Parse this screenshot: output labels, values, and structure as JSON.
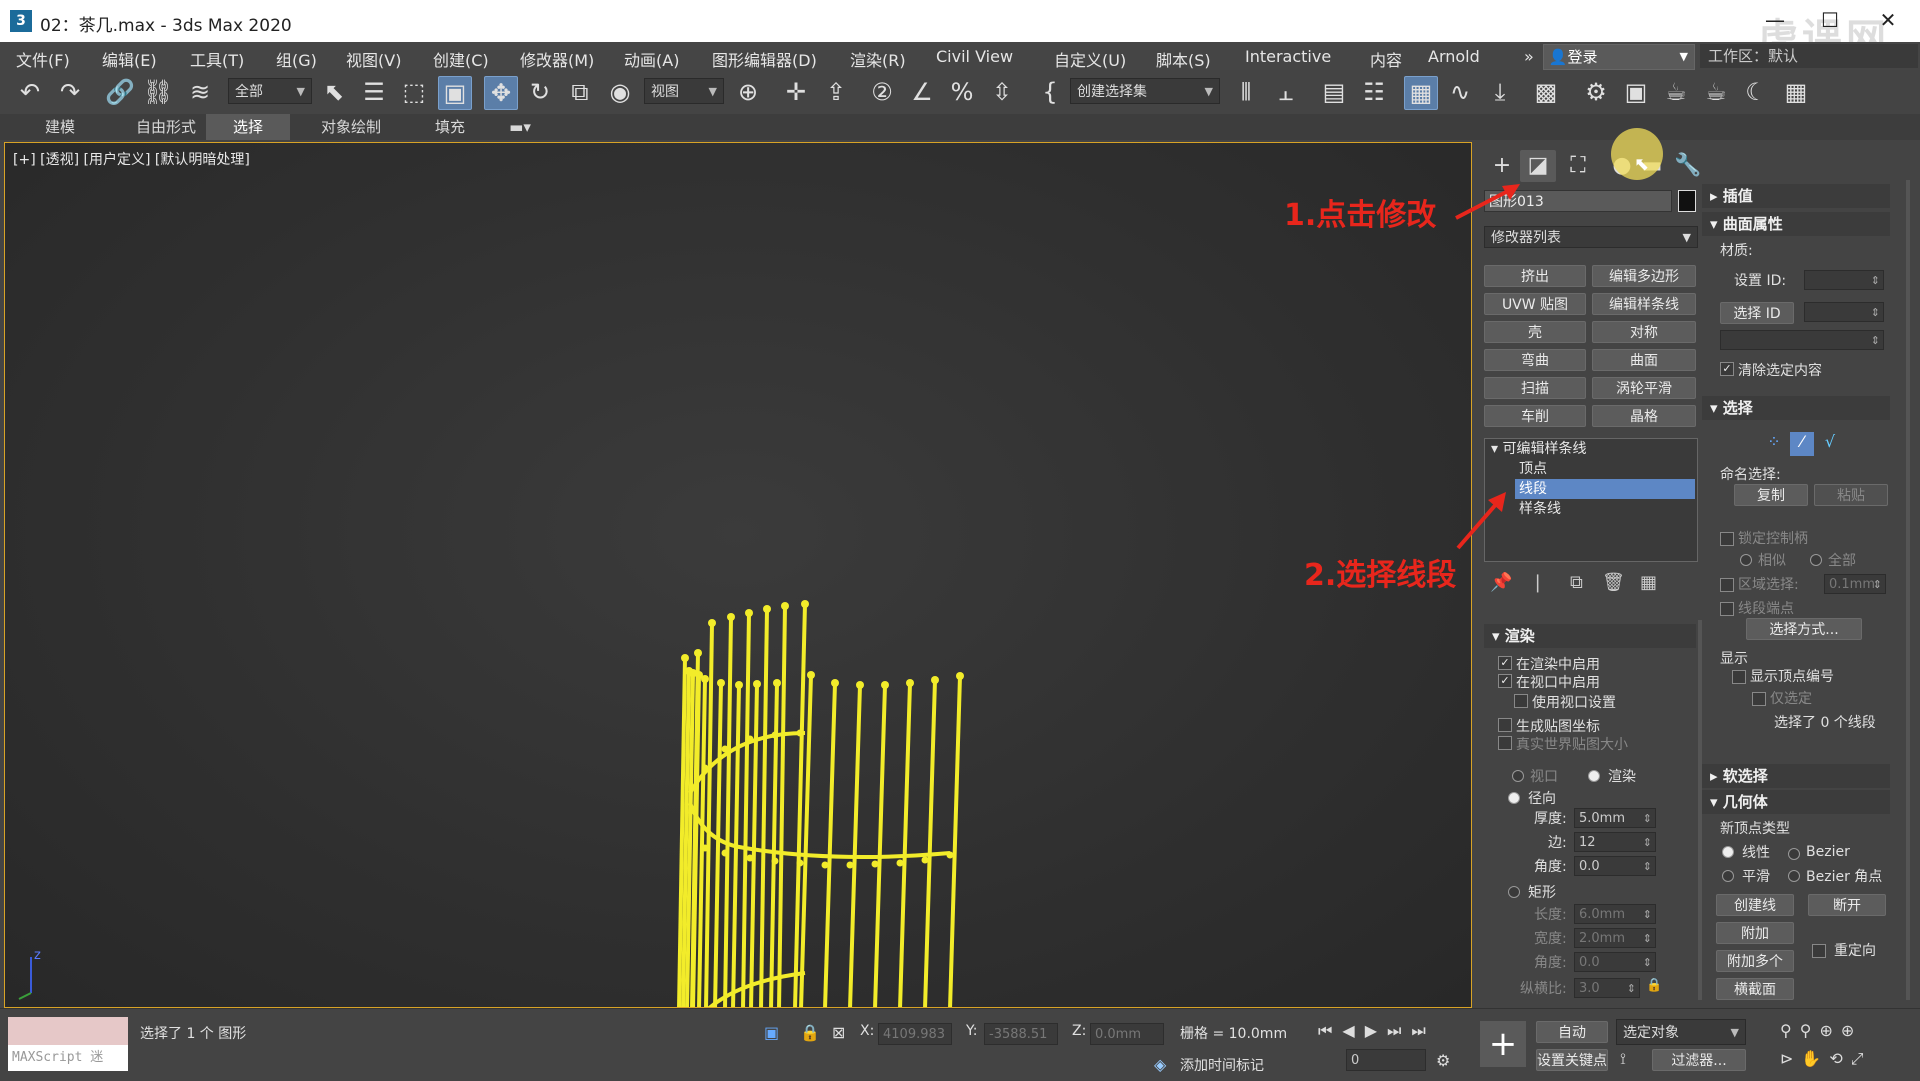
{
  "window": {
    "title": "02：茶几.max - 3ds Max 2020",
    "logo": "3",
    "minimize": "—",
    "maximize": "☐",
    "close": "✕",
    "watermark": "虎课网"
  },
  "menu": {
    "items": [
      "文件(F)",
      "编辑(E)",
      "工具(T)",
      "组(G)",
      "视图(V)",
      "创建(C)",
      "修改器(M)",
      "动画(A)",
      "图形编辑器(D)",
      "渲染(R)",
      "Civil View",
      "自定义(U)",
      "脚本(S)",
      "Interactive",
      "内容",
      "Arnold"
    ],
    "overflow": "»",
    "login": "登录",
    "workspace": "工作区：默认"
  },
  "toolbar": {
    "selection_filter": "全部",
    "ref_coord": "视图",
    "named_selection": "创建选择集"
  },
  "ribbon": {
    "tabs": [
      "建模",
      "自由形式",
      "选择",
      "对象绘制",
      "填充"
    ],
    "selected": "选择"
  },
  "viewport": {
    "label": "[+] [透视] [用户定义] [默认明暗处理]",
    "axis_z": "z",
    "object_color": "#f2ec2a"
  },
  "panel": {
    "object_name": "图形013",
    "modifier_list": "修改器列表",
    "modifier_buttons": [
      "挤出",
      "编辑多边形",
      "UVW 贴图",
      "编辑样条线",
      "壳",
      "对称",
      "弯曲",
      "曲面",
      "扫描",
      "涡轮平滑",
      "车削",
      "晶格"
    ],
    "stack": {
      "root": "可编辑样条线",
      "sub": [
        "顶点",
        "线段",
        "样条线"
      ],
      "selected": "线段"
    },
    "render": {
      "title": "渲染",
      "enable_render": "在渲染中启用",
      "enable_viewport": "在视口中启用",
      "use_viewport": "使用视口设置",
      "gen_map": "生成贴图坐标",
      "real_world": "真实世界贴图大小",
      "viewport": "视口",
      "render_opt": "渲染",
      "radial": "径向",
      "thickness_label": "厚度:",
      "thickness": "5.0mm",
      "sides_label": "边:",
      "sides": "12",
      "angle_label": "角度:",
      "angle": "0.0",
      "rect": "矩形",
      "length_label": "长度:",
      "length": "6.0mm",
      "width_label": "宽度:",
      "width": "2.0mm",
      "angle2_label": "角度:",
      "angle2": "0.0",
      "aspect_label": "纵横比:",
      "aspect": "3.0"
    },
    "right": {
      "interp": "插值",
      "surface": "曲面属性",
      "material": "材质:",
      "set_id": "设置 ID:",
      "select_id": "选择 ID",
      "clear_sel": "清除选定内容",
      "selection": "选择",
      "named_sel": "命名选择:",
      "copy": "复制",
      "paste": "粘贴",
      "lock_handles": "锁定控制柄",
      "alike": "相似",
      "all": "全部",
      "area_sel": "区域选择:",
      "area_val": "0.1mm",
      "seg_end": "线段端点",
      "sel_by": "选择方式...",
      "display": "显示",
      "show_vnum": "显示顶点编号",
      "sel_only": "仅选定",
      "sel_count": "选择了 0 个线段",
      "soft_sel": "软选择",
      "geometry": "几何体",
      "new_vtype": "新顶点类型",
      "linear": "线性",
      "bezier": "Bezier",
      "smooth": "平滑",
      "bezier_corner": "Bezier 角点",
      "create_line": "创建线",
      "break": "断开",
      "attach": "附加",
      "reorient": "重定向",
      "attach_mult": "附加多个",
      "cross_section": "横截面"
    }
  },
  "annotations": {
    "step1": "1.点击修改",
    "step2": "2.选择线段",
    "color": "#e8261c"
  },
  "status": {
    "maxscript": "MAXScript 迷",
    "selected": "选择了 1 个 图形",
    "x_label": "X:",
    "x": "4109.983",
    "y_label": "Y:",
    "y": "-3588.51",
    "z_label": "Z:",
    "z": "0.0mm",
    "grid": "栅格 = 10.0mm",
    "add_time_tag": "添加时间标记",
    "auto": "自动",
    "sel_obj": "选定对象",
    "set_key": "设置关键点",
    "filter": "过滤器...",
    "frame": "0"
  }
}
